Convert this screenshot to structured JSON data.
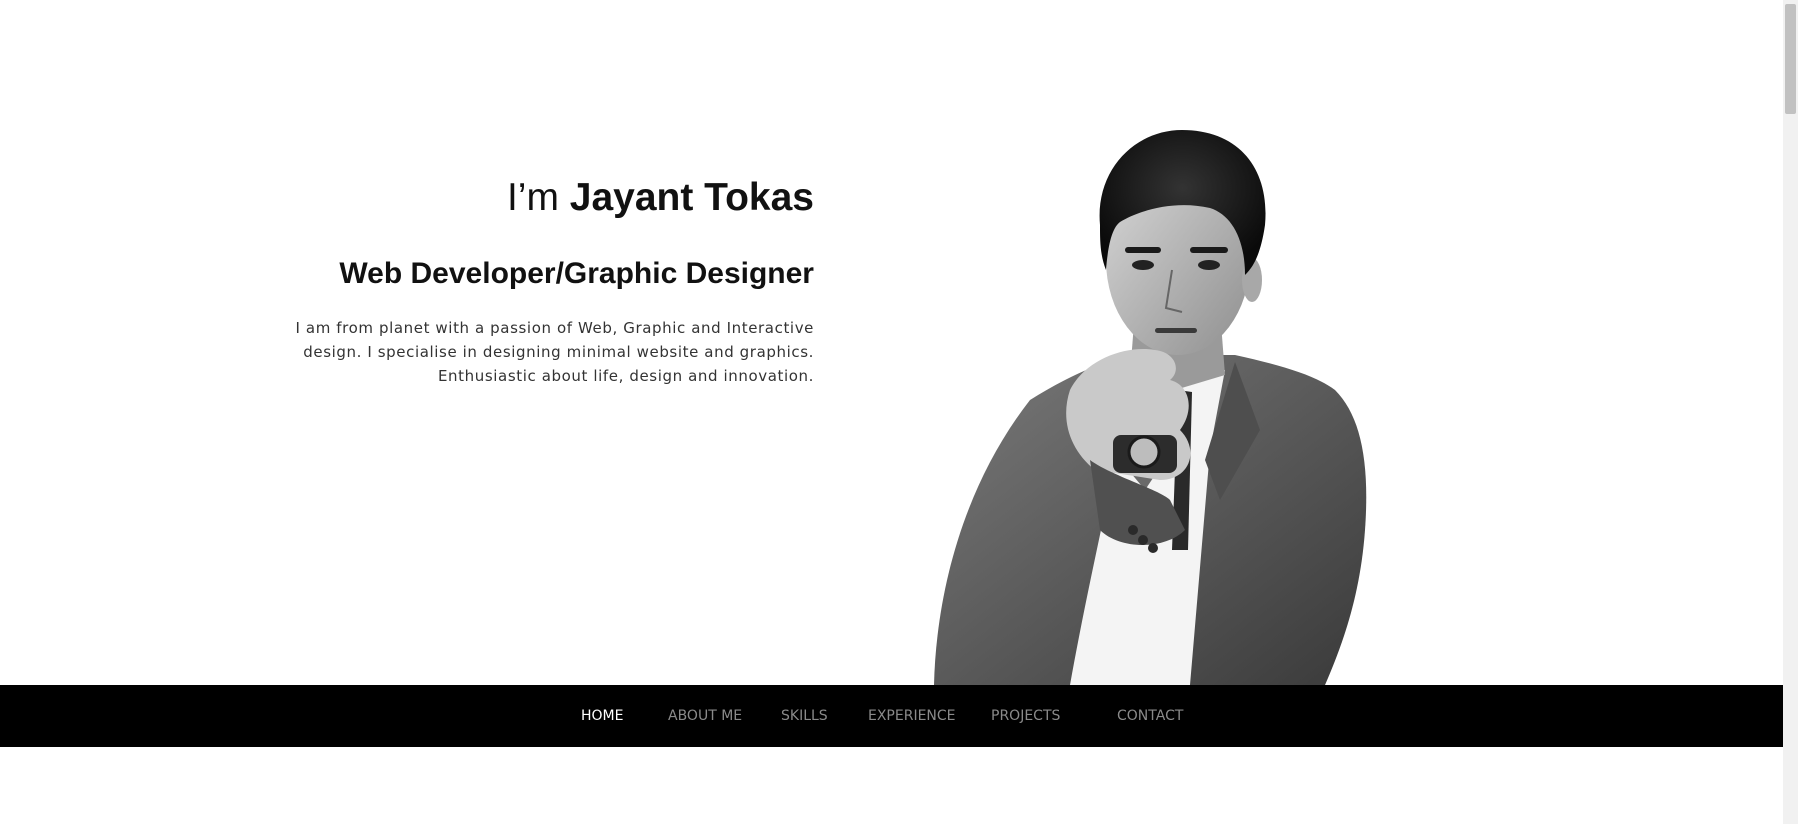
{
  "hero": {
    "greeting_prefix": "I’m ",
    "name": "Jayant Tokas",
    "role": "Web Developer/Graphic Designer",
    "bio": "I am from planet with a passion of Web, Graphic and Interactive design. I specialise in designing minimal website and graphics. Enthusiastic about life, design and innovation."
  },
  "portrait": {
    "icon": "person-portrait-icon"
  },
  "nav": {
    "items": [
      {
        "label": "HOME",
        "active": true
      },
      {
        "label": "ABOUT ME",
        "active": false
      },
      {
        "label": "SKILLS",
        "active": false
      },
      {
        "label": "EXPERIENCE",
        "active": false
      },
      {
        "label": "PROJECTS",
        "active": false
      },
      {
        "label": "CONTACT",
        "active": false
      }
    ]
  },
  "colors": {
    "background": "#ffffff",
    "navbar": "#000000",
    "nav_active": "#ffffff",
    "nav_inactive": "#8a8a8a",
    "text": "#111111"
  }
}
